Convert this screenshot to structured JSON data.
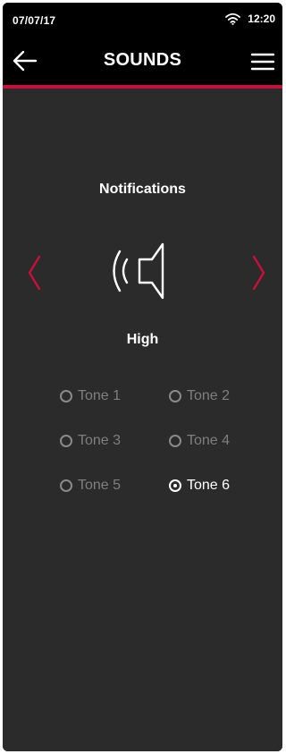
{
  "status_bar": {
    "date": "07/07/17",
    "time": "12:20",
    "wifi_icon": "wifi-icon"
  },
  "header": {
    "title": "SOUNDS",
    "back_icon": "arrow-left-icon",
    "menu_icon": "hamburger-menu-icon"
  },
  "colors": {
    "accent": "#c8103e",
    "background": "#2b2b2b",
    "bar": "#000000"
  },
  "sound": {
    "category": "Notifications",
    "level": "High",
    "icon": "speaker-icon",
    "prev_icon": "chevron-left-icon",
    "next_icon": "chevron-right-icon"
  },
  "tones": [
    {
      "label": "Tone 1",
      "selected": false
    },
    {
      "label": "Tone 2",
      "selected": false
    },
    {
      "label": "Tone 3",
      "selected": false
    },
    {
      "label": "Tone 4",
      "selected": false
    },
    {
      "label": "Tone 5",
      "selected": false
    },
    {
      "label": "Tone 6",
      "selected": true
    }
  ]
}
